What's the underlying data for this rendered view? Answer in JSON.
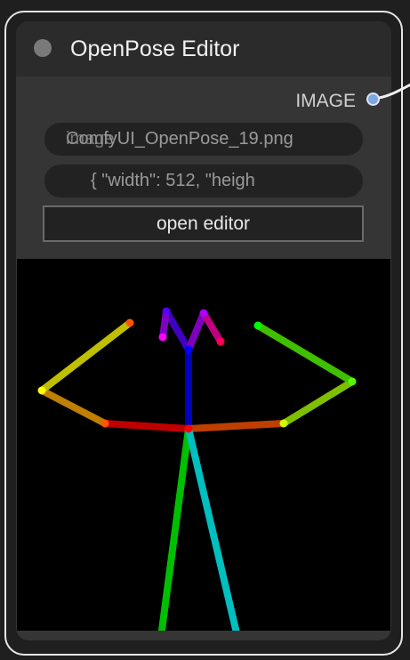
{
  "node": {
    "title": "OpenPose Editor"
  },
  "output": {
    "label": "IMAGE",
    "slot_color": "#7fa6e0"
  },
  "widgets": {
    "image_value": "ComfyUI_OpenPose_19.png",
    "image_overlay_value": "image",
    "json_value": "{     \"width\": 512,     \"heigh",
    "open_editor_label": "open editor"
  },
  "pose": {
    "limb_colors": [
      "#ff0000",
      "#ff5500",
      "#ffaa00",
      "#ffff00",
      "#aaff00",
      "#55ff00",
      "#00ff00",
      "#00ff55",
      "#00ffaa",
      "#00ffff",
      "#00aaff",
      "#0055ff",
      "#0000ff",
      "#5500ff",
      "#aa00ff",
      "#ff00ff",
      "#ff00aa"
    ]
  }
}
